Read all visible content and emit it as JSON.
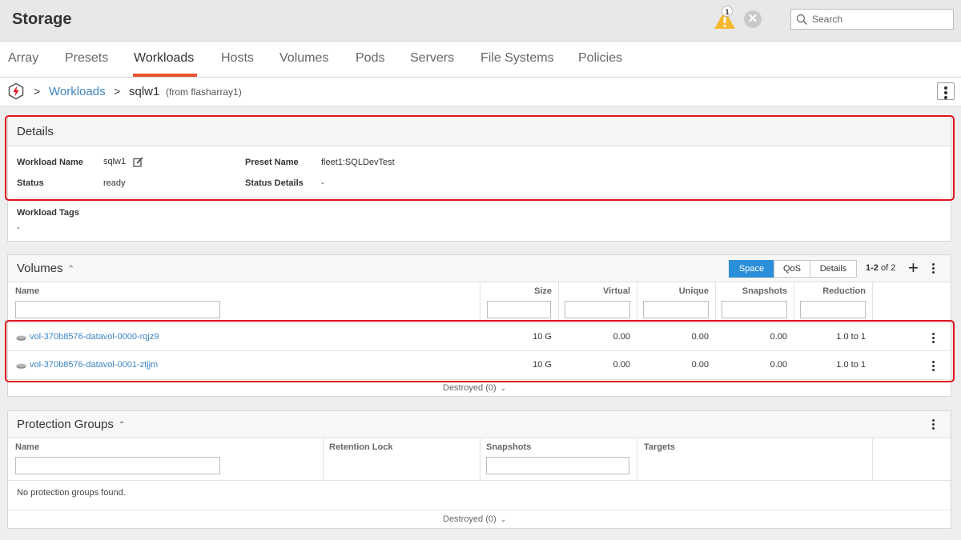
{
  "app": {
    "title": "Storage"
  },
  "header": {
    "alert_count": "1",
    "search_placeholder": "Search"
  },
  "tabs": [
    {
      "label": "Array"
    },
    {
      "label": "Presets"
    },
    {
      "label": "Workloads"
    },
    {
      "label": "Hosts"
    },
    {
      "label": "Volumes"
    },
    {
      "label": "Pods"
    },
    {
      "label": "Servers"
    },
    {
      "label": "File Systems"
    },
    {
      "label": "Policies"
    }
  ],
  "active_tab": "Workloads",
  "breadcrumb": {
    "sep": ">",
    "parent": "Workloads",
    "current": "sqlw1",
    "source": "(from flasharray1)"
  },
  "details": {
    "title": "Details",
    "workload_name_label": "Workload Name",
    "workload_name_value": "sqlw1",
    "preset_name_label": "Preset Name",
    "preset_name_value": "fleet1:SQLDevTest",
    "status_label": "Status",
    "status_value": "ready",
    "status_details_label": "Status Details",
    "status_details_value": "-",
    "tags_label": "Workload Tags",
    "tags_value": "-"
  },
  "volumes": {
    "title": "Volumes",
    "view_buttons": [
      "Space",
      "QoS",
      "Details"
    ],
    "active_view": "Space",
    "pager_range": "1-2",
    "pager_of": "of 2",
    "columns": [
      "Name",
      "Size",
      "Virtual",
      "Unique",
      "Snapshots",
      "Reduction"
    ],
    "rows": [
      {
        "name": "vol-370b8576-datavol-0000-rqjz9",
        "size": "10 G",
        "virtual": "0.00",
        "unique": "0.00",
        "snapshots": "0.00",
        "reduction": "1.0 to 1"
      },
      {
        "name": "vol-370b8576-datavol-0001-ztjjm",
        "size": "10 G",
        "virtual": "0.00",
        "unique": "0.00",
        "snapshots": "0.00",
        "reduction": "1.0 to 1"
      }
    ],
    "destroyed": "Destroyed (0)"
  },
  "protection_groups": {
    "title": "Protection Groups",
    "columns": [
      "Name",
      "Retention Lock",
      "Snapshots",
      "Targets"
    ],
    "empty": "No protection groups found.",
    "destroyed": "Destroyed (0)"
  },
  "colors": {
    "accent": "#e8552d",
    "link": "#3b84c4",
    "active_button": "#2b8ed8",
    "highlight": "#e2131f",
    "warning": "#f5b82e"
  }
}
